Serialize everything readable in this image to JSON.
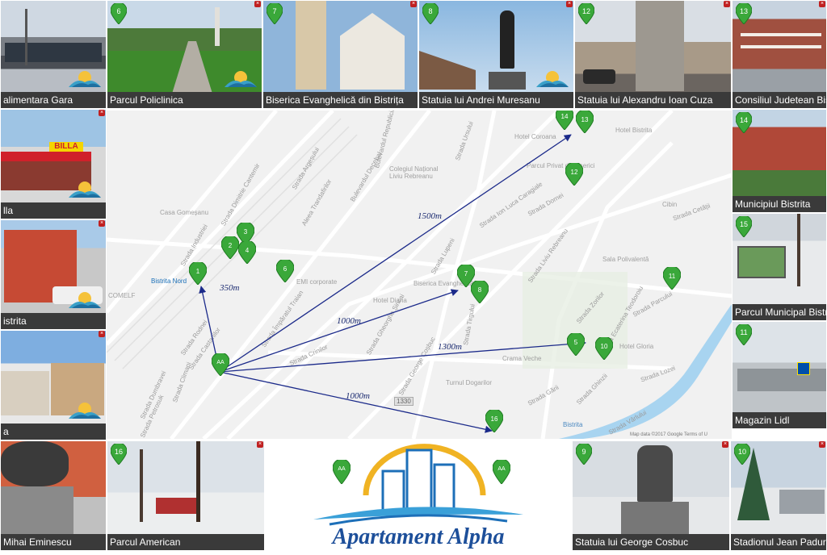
{
  "tiles_top": [
    {
      "id": "t-gara",
      "caption": "alimentara Gara",
      "num": "",
      "badge": true
    },
    {
      "id": "t-policlinica",
      "caption": "Parcul Policlinica",
      "num": "6",
      "badge": true
    },
    {
      "id": "t-biserica",
      "caption": "Biserica Evanghelică din Bistrița",
      "num": "7",
      "badge": false
    },
    {
      "id": "t-muresanu",
      "caption": "Statuia lui Andrei Muresanu",
      "num": "8",
      "badge": true
    },
    {
      "id": "t-cuza",
      "caption": "Statuia lui Alexandru Ioan Cuza",
      "num": "12",
      "badge": false
    },
    {
      "id": "t-consiliul",
      "caption": "Consiliul Judetean Bis",
      "num": "13",
      "badge": false
    }
  ],
  "tiles_left": [
    {
      "id": "t-billa",
      "caption": "lla",
      "sign": "BILLA",
      "badge": true
    },
    {
      "id": "t-autogara",
      "caption": "istrita",
      "badge": true
    },
    {
      "id": "t-hotel",
      "caption": "a",
      "badge": true
    }
  ],
  "tiles_right": [
    {
      "id": "t-municipiul",
      "caption": "Municipiul Bistrita",
      "num": "14"
    },
    {
      "id": "t-parcmun",
      "caption": "Parcul Municipal Bistri",
      "num": "15"
    },
    {
      "id": "t-lidl",
      "caption": "Magazin Lidl",
      "num": "11"
    }
  ],
  "tiles_bottom": [
    {
      "id": "t-eminescu",
      "caption": "Mihai Eminescu",
      "num": ""
    },
    {
      "id": "t-american",
      "caption": "Parcul American",
      "num": "16"
    },
    {
      "id": "t-cosbuc",
      "caption": "Statuia lui George Cosbuc",
      "num": "9"
    },
    {
      "id": "t-stadion",
      "caption": "Stadionul Jean Padure",
      "num": "10"
    }
  ],
  "map": {
    "home_label": "AA",
    "distances": {
      "d350": "350m",
      "d1000a": "1000m",
      "d1500": "1500m",
      "d1300": "1300m",
      "d1000b": "1000m"
    },
    "markers": [
      "1",
      "2",
      "3",
      "4",
      "5",
      "6",
      "7",
      "8",
      "10",
      "11",
      "12",
      "13",
      "14",
      "16"
    ],
    "station": "Bistrita Nord",
    "comelf": "COMELF",
    "credit": "Map data ©2017 Google   Terms of U",
    "bistrita_river": "Bistrita",
    "streets": [
      "Strada Industriei",
      "Strada Dimitrie Cantemir",
      "Strada Argeșului",
      "Aleea Trandafirilor",
      "Bulevardul Decebal",
      "Strada Rodnei",
      "Strada Castanilor",
      "Strada Împăratul Traian",
      "Strada Crinilor",
      "Strada Climani",
      "Strada Dumbravei",
      "Strada Petrosuk",
      "Strada Lupeni",
      "Strada Gheorghe Șincai",
      "Strada George Coșbuc",
      "Strada Ion Luca Caragiale",
      "Strada Dornei",
      "Strada Zorilor",
      "Strada Parcului",
      "Strada Ecaterina Teodoroiu",
      "Strada Cetății",
      "Strada Ursului",
      "Strada Gării",
      "Strada Lozei",
      "Bulevardul Republicii",
      "Strada Liviu Rebreanu",
      "Strada Tirgului",
      "Strada Ghinzii",
      "Strada Vârlului"
    ],
    "pois": [
      "Casa Gomeșanu",
      "EMI corporate",
      "Hotel Coroana",
      "Hotel Bistrita",
      "Colegiul Național Liviu Rebreanu",
      "Sala Polivalentă",
      "Biserica Evanghelică",
      "Cibin",
      "Crama Veche",
      "Turnul Dogarilor",
      "Hotel Diana",
      "Parcul Privat de Biserici",
      "Hotel Gloria"
    ],
    "road_badge": "1330"
  },
  "logo": {
    "brand": "Apartament Alpha",
    "left_pin": "AA",
    "right_pin": "AA"
  },
  "colors": {
    "pin": "#3aa83a",
    "pin_dark": "#1f7a22",
    "arrow": "#1b2a8a",
    "caption_bg": "#3a3a3a",
    "logo_blue": "#1d6fb8",
    "logo_sun": "#f0b323",
    "river": "#a8d4f0"
  }
}
